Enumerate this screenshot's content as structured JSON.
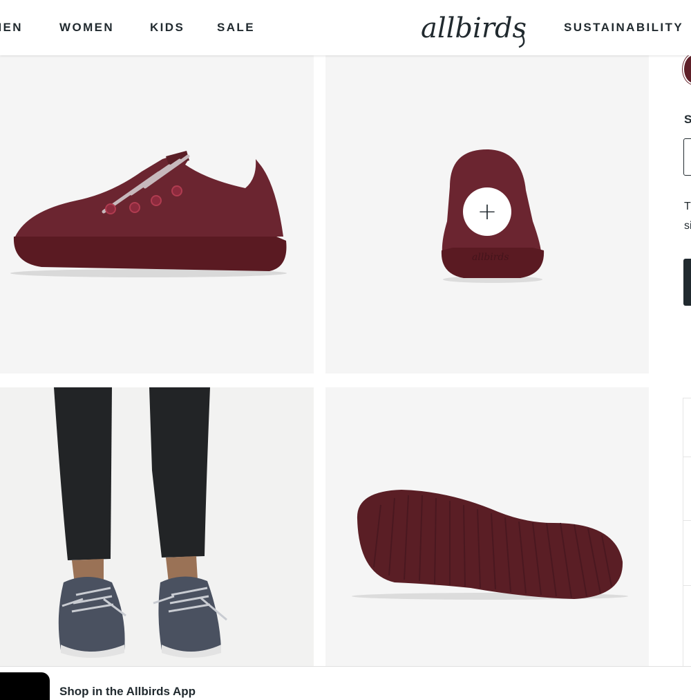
{
  "header": {
    "nav_items": [
      "MEN",
      "WOMEN",
      "KIDS",
      "SALE"
    ],
    "logo_text": "allbirds",
    "right_nav": [
      "SUSTAINABILITY"
    ]
  },
  "gallery": {
    "images": [
      {
        "name": "shoe-side-view",
        "color": "#5e1f28"
      },
      {
        "name": "shoe-back-view",
        "color": "#5e1f28",
        "logo_text": "allbirds"
      },
      {
        "name": "model-wearing-shoes",
        "color": "#4a5160"
      },
      {
        "name": "shoe-sole-view",
        "color": "#5a1e25"
      }
    ],
    "zoom_icon": "plus-icon",
    "zoom_symbol": "+"
  },
  "sidebar": {
    "size_label": "S",
    "note_lines": [
      "T",
      "si"
    ]
  },
  "app_banner": {
    "text": "Shop in the Allbirds App"
  },
  "colors": {
    "accent": "#212a2f",
    "product": "#5e1f28",
    "tile_bg": "#f5f5f5"
  }
}
